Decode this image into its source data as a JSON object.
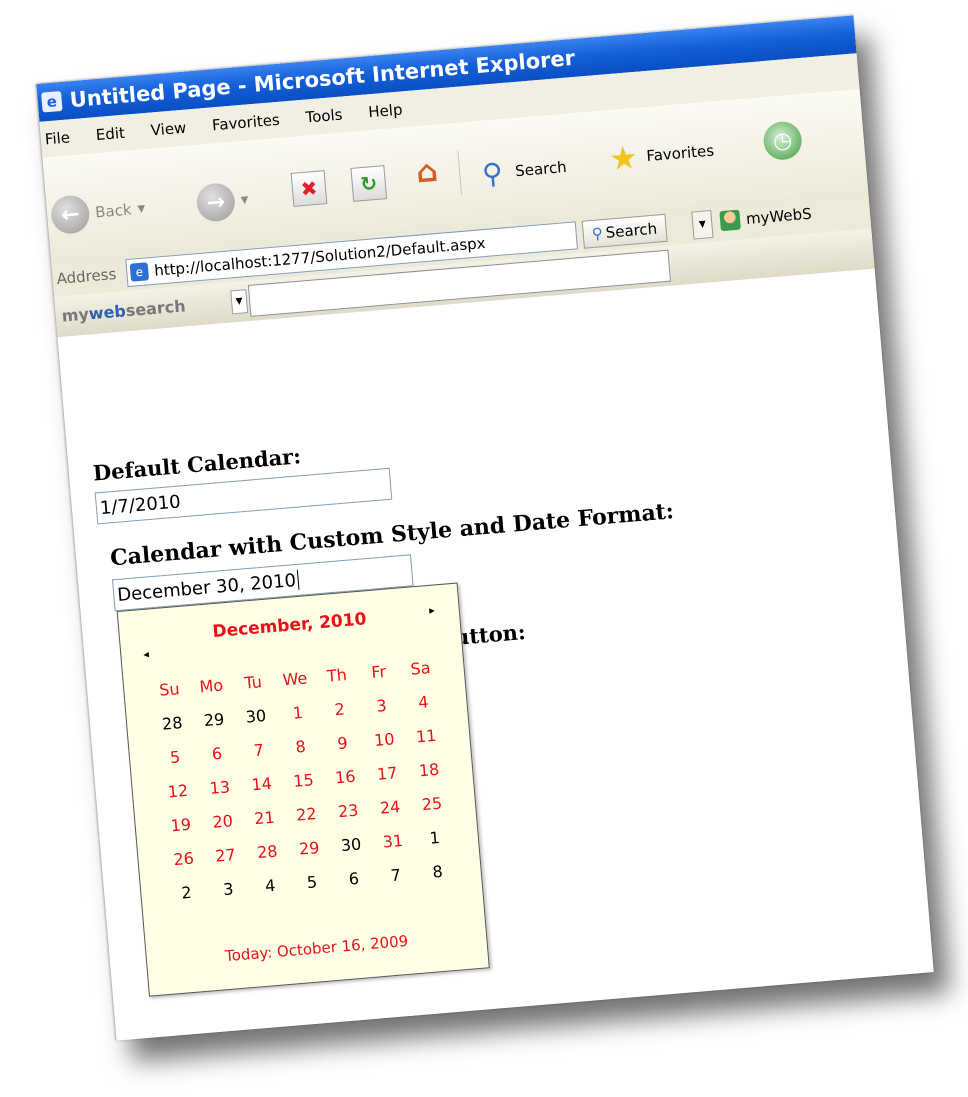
{
  "window": {
    "title": "Untitled Page - Microsoft Internet Explorer"
  },
  "menu": [
    "File",
    "Edit",
    "View",
    "Favorites",
    "Tools",
    "Help"
  ],
  "toolbar": {
    "back_label": "Back",
    "search_label": "Search",
    "favorites_label": "Favorites"
  },
  "address": {
    "label": "Address",
    "url": "http://localhost:1277/Solution2/Default.aspx",
    "search_button": "Search",
    "myweb_label": "myWebS"
  },
  "search_toolbar": {
    "brand_prefix": "my",
    "brand_mid": "web",
    "brand_suffix": "search",
    "input_value": ""
  },
  "page": {
    "default_label": "Default Calendar:",
    "default_value": "1/7/2010",
    "custom_label": "Calendar with Custom Style and Date Format:",
    "custom_value": "December 30, 2010",
    "hidden_label_partial": "utton:"
  },
  "calendar": {
    "title": "December, 2010",
    "prev": "◂",
    "next": "▸",
    "weekdays": [
      "Su",
      "Mo",
      "Tu",
      "We",
      "Th",
      "Fr",
      "Sa"
    ],
    "weeks": [
      [
        {
          "d": "28",
          "t": "o"
        },
        {
          "d": "29",
          "t": "o"
        },
        {
          "d": "30",
          "t": "o"
        },
        {
          "d": "1",
          "t": "c"
        },
        {
          "d": "2",
          "t": "c"
        },
        {
          "d": "3",
          "t": "c"
        },
        {
          "d": "4",
          "t": "c"
        }
      ],
      [
        {
          "d": "5",
          "t": "c"
        },
        {
          "d": "6",
          "t": "c"
        },
        {
          "d": "7",
          "t": "c"
        },
        {
          "d": "8",
          "t": "c"
        },
        {
          "d": "9",
          "t": "c"
        },
        {
          "d": "10",
          "t": "c"
        },
        {
          "d": "11",
          "t": "c"
        }
      ],
      [
        {
          "d": "12",
          "t": "c"
        },
        {
          "d": "13",
          "t": "c"
        },
        {
          "d": "14",
          "t": "c"
        },
        {
          "d": "15",
          "t": "c"
        },
        {
          "d": "16",
          "t": "c"
        },
        {
          "d": "17",
          "t": "c"
        },
        {
          "d": "18",
          "t": "c"
        }
      ],
      [
        {
          "d": "19",
          "t": "c"
        },
        {
          "d": "20",
          "t": "c"
        },
        {
          "d": "21",
          "t": "c"
        },
        {
          "d": "22",
          "t": "c"
        },
        {
          "d": "23",
          "t": "c"
        },
        {
          "d": "24",
          "t": "c"
        },
        {
          "d": "25",
          "t": "c"
        }
      ],
      [
        {
          "d": "26",
          "t": "c"
        },
        {
          "d": "27",
          "t": "c"
        },
        {
          "d": "28",
          "t": "c"
        },
        {
          "d": "29",
          "t": "c"
        },
        {
          "d": "30",
          "t": "s"
        },
        {
          "d": "31",
          "t": "c"
        },
        {
          "d": "1",
          "t": "o"
        }
      ],
      [
        {
          "d": "2",
          "t": "o"
        },
        {
          "d": "3",
          "t": "o"
        },
        {
          "d": "4",
          "t": "o"
        },
        {
          "d": "5",
          "t": "o"
        },
        {
          "d": "6",
          "t": "o"
        },
        {
          "d": "7",
          "t": "o"
        },
        {
          "d": "8",
          "t": "o"
        }
      ]
    ],
    "today_text": "Today: October 16, 2009"
  },
  "colors": {
    "title_bar": "#1460d8",
    "calendar_bg": "#ffffe6",
    "calendar_accent": "#e8101a"
  }
}
